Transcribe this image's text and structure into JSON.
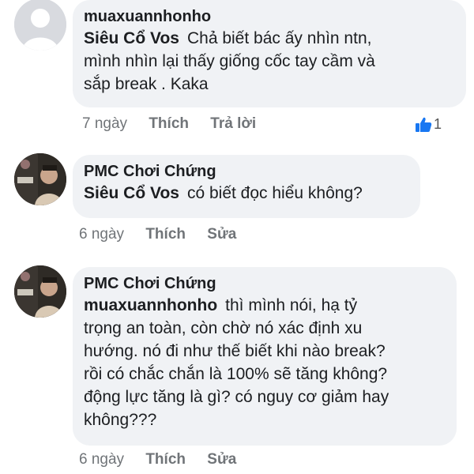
{
  "comments": [
    {
      "author": "muaxuannhonho",
      "mention": "Siêu Cổ Vos",
      "lines": [
        "Chả biết bác ấy nhìn ntn,",
        "mình nhìn lại thấy giống cốc tay cầm và",
        "sắp break . Kaka"
      ],
      "time": "7 ngày",
      "action1": "Thích",
      "action2": "Trả lời",
      "likes": "1"
    },
    {
      "author": "PMC Chơi Chứng",
      "mention": "Siêu Cổ Vos",
      "lines": [
        "có biết đọc hiểu không?"
      ],
      "time": "6 ngày",
      "action1": "Thích",
      "action2": "Sửa"
    },
    {
      "author": "PMC Chơi Chứng",
      "mention": "muaxuannhonho",
      "lines": [
        "thì mình nói, hạ tỷ",
        "trọng an toàn, còn chờ nó xác định xu",
        "hướng. nó đi như thế biết khi nào break?",
        "rồi có chắc chắn là 100% sẽ tăng không?",
        "động lực tăng là gì? có nguy cơ giảm hay",
        "không???"
      ],
      "time": "6 ngày",
      "action1": "Thích",
      "action2": "Sửa"
    }
  ],
  "icons": {
    "default_avatar": "person-silhouette-icon",
    "like": "thumbs-up-icon"
  },
  "colors": {
    "bubble": "#f0f2f5",
    "like_blue": "#1877f2",
    "meta_gray": "#707478"
  }
}
